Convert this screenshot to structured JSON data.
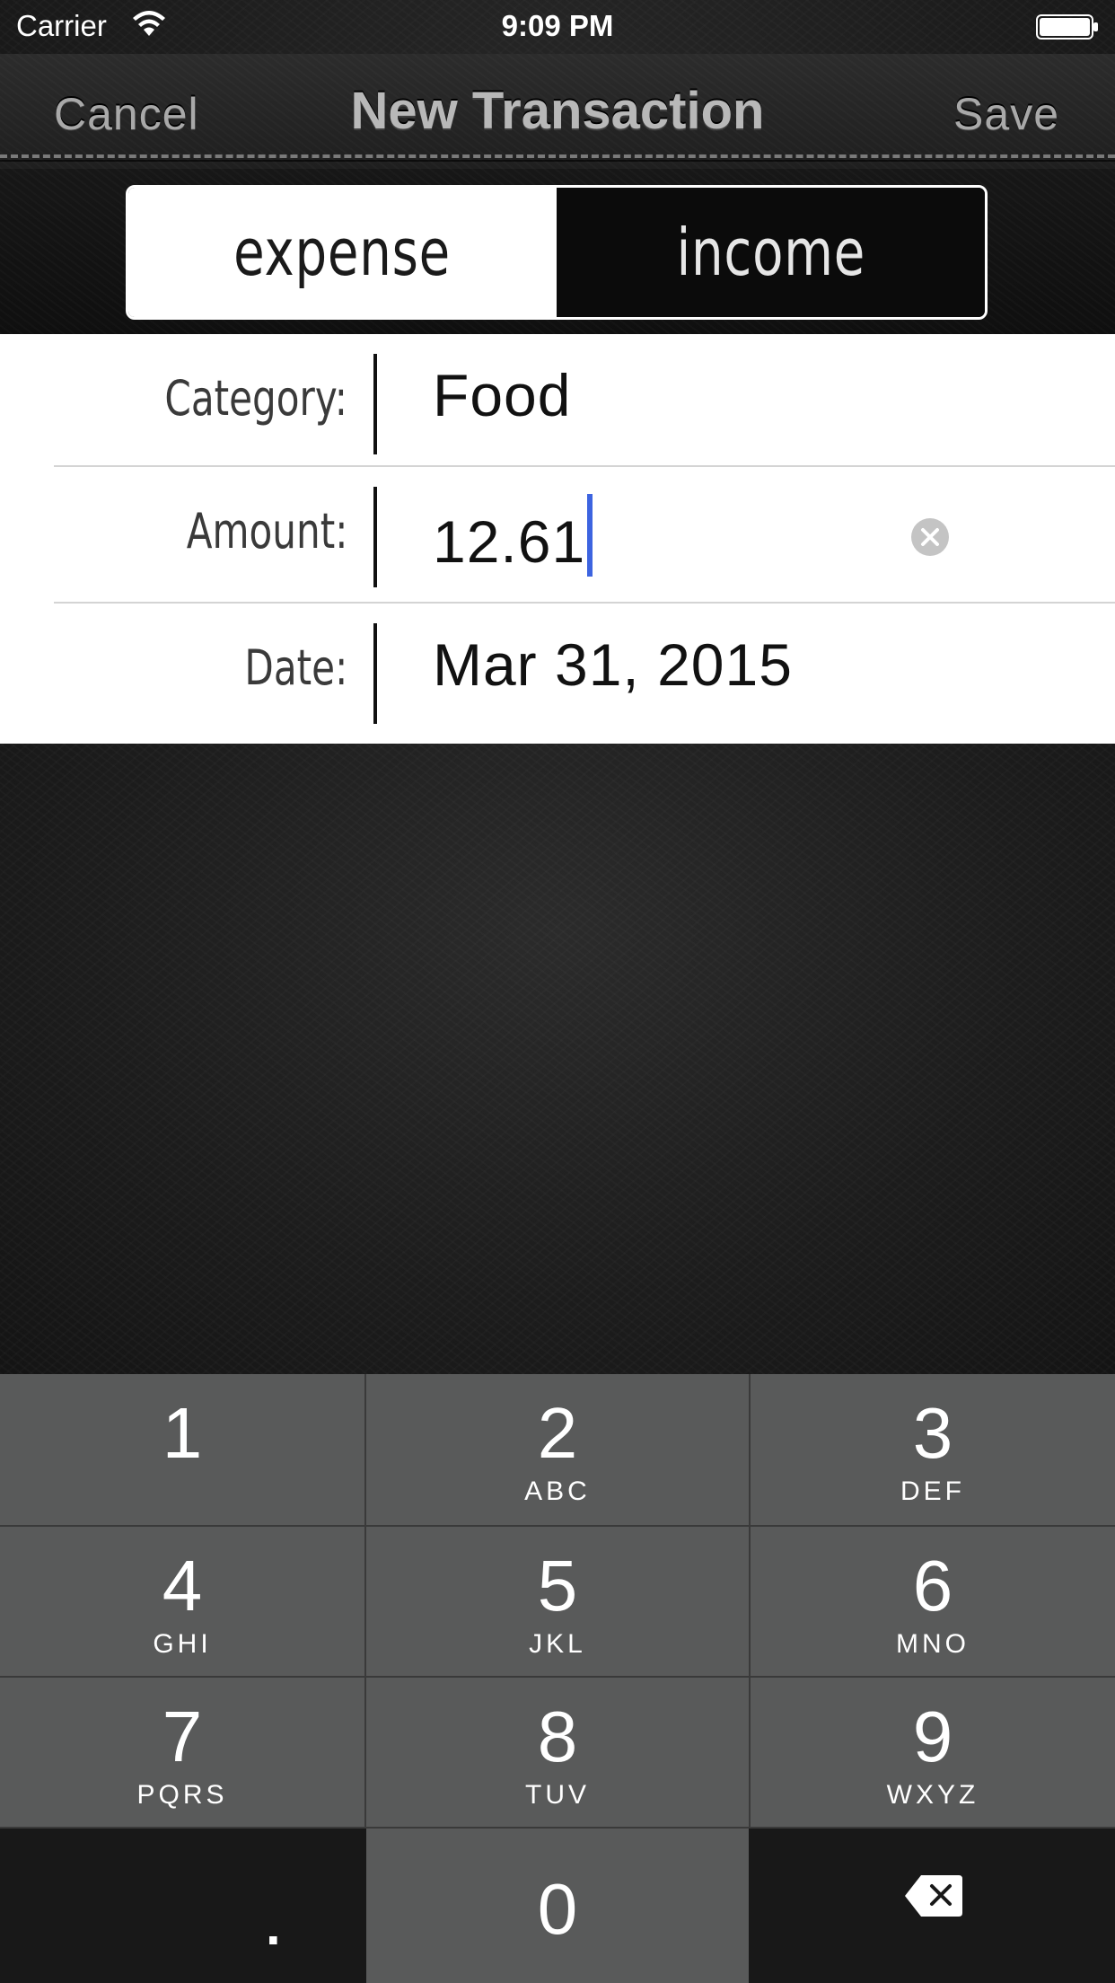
{
  "status_bar": {
    "carrier": "Carrier",
    "time": "9:09 PM",
    "wifi_icon": "wifi-icon",
    "battery_icon": "battery-icon"
  },
  "nav_bar": {
    "cancel_label": "Cancel",
    "title": "New Transaction",
    "save_label": "Save"
  },
  "segmented_control": {
    "segments": [
      "expense",
      "income"
    ],
    "selected": "expense"
  },
  "form": {
    "category": {
      "label": "Category:",
      "value": "Food"
    },
    "amount": {
      "label": "Amount:",
      "value": "12.61",
      "clear_icon": "clear-icon"
    },
    "date": {
      "label": "Date:",
      "value": "Mar 31, 2015"
    }
  },
  "keypad": {
    "keys": [
      {
        "number": "1",
        "letters": ""
      },
      {
        "number": "2",
        "letters": "ABC"
      },
      {
        "number": "3",
        "letters": "DEF"
      },
      {
        "number": "4",
        "letters": "GHI"
      },
      {
        "number": "5",
        "letters": "JKL"
      },
      {
        "number": "6",
        "letters": "MNO"
      },
      {
        "number": "7",
        "letters": "PQRS"
      },
      {
        "number": "8",
        "letters": "TUV"
      },
      {
        "number": "9",
        "letters": "WXYZ"
      }
    ],
    "decimal": ".",
    "zero": "0",
    "delete_icon": "delete-icon"
  },
  "colors": {
    "cursor": "#3d64e0",
    "key_background": "#595a5a",
    "key_dark_background": "#181818",
    "nav_text": "#a9a9a9"
  }
}
